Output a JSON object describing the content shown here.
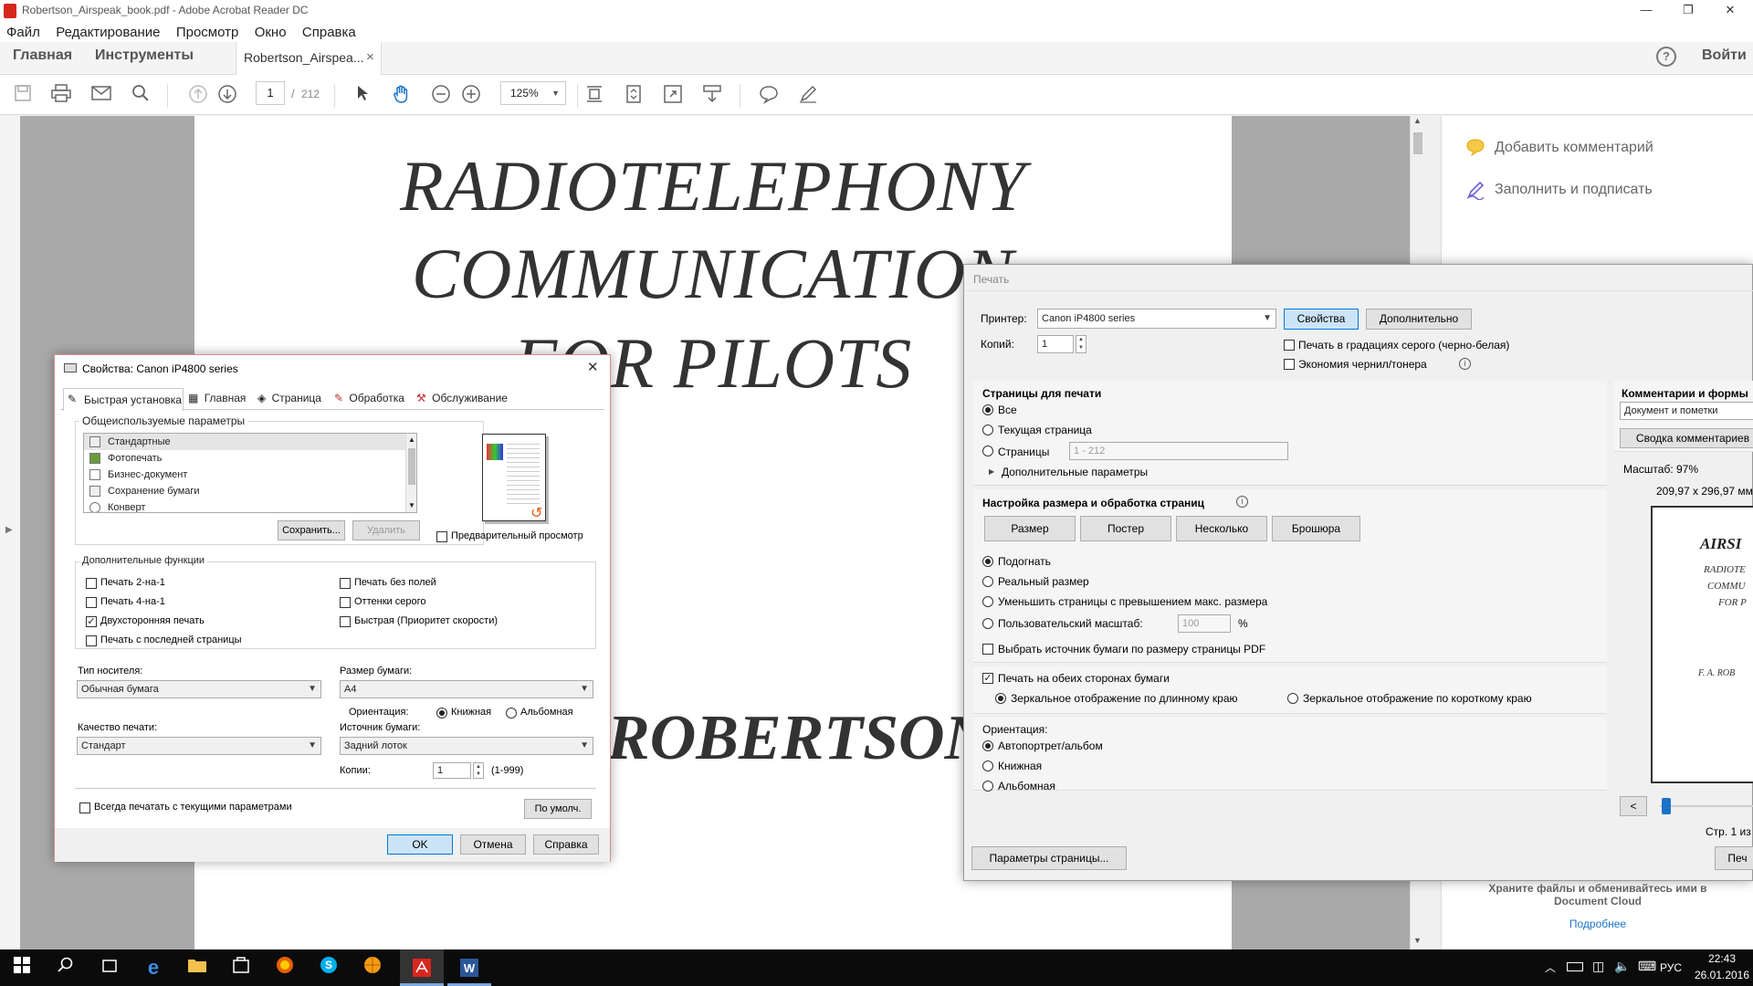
{
  "window": {
    "title": "Robertson_Airspeak_book.pdf - Adobe Acrobat Reader DC",
    "minimize": "—",
    "maximize": "❐",
    "close": "✕"
  },
  "menu": [
    "Файл",
    "Редактирование",
    "Просмотр",
    "Окно",
    "Справка"
  ],
  "tabs": {
    "home": "Главная",
    "tools": "Инструменты",
    "doc": "Robertson_Airspea...",
    "doc_close": "×",
    "help_icon": "?",
    "signin": "Войти"
  },
  "toolbar": {
    "page_current": "1",
    "page_sep": "/",
    "page_total": "212",
    "zoom": "125%"
  },
  "document": {
    "title_line1": "RADIOTELEPHONY",
    "title_line2": "COMMUNICATION",
    "title_line3": "FOR PILOTS",
    "author": "ROBERTSON"
  },
  "right_panel": {
    "add_comment": "Добавить комментарий",
    "fill_sign": "Заполнить и подписать",
    "cloud_text": "Храните файлы и обменивайтесь ими в Document Cloud",
    "more_link": "Подробнее"
  },
  "print_dialog": {
    "title": "Печать",
    "printer_label": "Принтер:",
    "printer_value": "Canon iP4800 series",
    "properties_btn": "Свойства",
    "advanced_btn": "Дополнительно",
    "copies_label": "Копий:",
    "copies_value": "1",
    "grayscale": "Печать в градациях серого (черно-белая)",
    "save_ink": "Экономия чернил/тонера",
    "pages_header": "Страницы для печати",
    "pages_all": "Все",
    "pages_current": "Текущая страница",
    "pages_range": "Страницы",
    "pages_range_value": "1 - 212",
    "more_options": "Дополнительные параметры",
    "size_header": "Настройка размера и обработка страниц",
    "size_btn": "Размер",
    "poster_btn": "Постер",
    "multiple_btn": "Несколько",
    "booklet_btn": "Брошюра",
    "fit": "Подогнать",
    "actual": "Реальный размер",
    "shrink": "Уменьшить страницы с превышением макс. размера",
    "custom_scale": "Пользовательский масштаб:",
    "custom_scale_value": "100",
    "percent": "%",
    "choose_source": "Выбрать источник бумаги по размеру страницы PDF",
    "duplex": "Печать на обеих сторонах бумаги",
    "flip_long": "Зеркальное отображение по длинному краю",
    "flip_short": "Зеркальное отображение по короткому краю",
    "orientation_label": "Ориентация:",
    "orient_auto": "Автопортрет/альбом",
    "orient_portrait": "Книжная",
    "orient_landscape": "Альбомная",
    "page_setup_btn": "Параметры страницы...",
    "comments_header": "Комментарии и формы",
    "comments_value": "Документ и пометки",
    "summary_btn": "Сводка комментариев",
    "scale_label": "Масштаб:  97%",
    "paper_dims": "209,97 x 296,97 мм",
    "preview_title": "AIRSI",
    "preview_l1": "RADIOTE",
    "preview_l2": "COMMU",
    "preview_l3": "FOR P",
    "preview_author": "F. A. ROB",
    "prev_btn": "<",
    "page_of": "Стр. 1 из",
    "print_btn": "Печ"
  },
  "props_dialog": {
    "title": "Свойства: Canon iP4800 series",
    "close": "✕",
    "tabs": [
      "Быстрая установка",
      "Главная",
      "Страница",
      "Обработка",
      "Обслуживание"
    ],
    "common_group": "Общеиспользуемые параметры",
    "presets": [
      "Стандартные",
      "Фотопечать",
      "Бизнес-документ",
      "Сохранение бумаги",
      "Конверт"
    ],
    "save_btn": "Сохранить...",
    "delete_btn": "Удалить",
    "preview": "Предварительный просмотр",
    "extra_group": "Дополнительные функции",
    "opt_2in1": "Печать 2-на-1",
    "opt_4in1": "Печать 4-на-1",
    "opt_duplex": "Двухсторонняя печать",
    "opt_lastpage": "Печать с последней страницы",
    "opt_borderless": "Печать без полей",
    "opt_gray": "Оттенки серого",
    "opt_fast": "Быстрая (Приоритет скорости)",
    "media_label": "Тип носителя:",
    "media_value": "Обычная бумага",
    "size_label": "Размер бумаги:",
    "size_value": "A4",
    "orientation_label": "Ориентация:",
    "portrait": "Книжная",
    "landscape": "Альбомная",
    "quality_label": "Качество печати:",
    "quality_value": "Стандарт",
    "source_label": "Источник бумаги:",
    "source_value": "Задний лоток",
    "copies_label": "Копии:",
    "copies_value": "1",
    "copies_range": "(1-999)",
    "always_print": "Всегда печатать с текущими параметрами",
    "defaults_btn": "По умолч.",
    "ok_btn": "OK",
    "cancel_btn": "Отмена",
    "help_btn": "Справка"
  },
  "taskbar": {
    "lang": "РУС",
    "time": "22:43",
    "date": "26.01.2016"
  }
}
